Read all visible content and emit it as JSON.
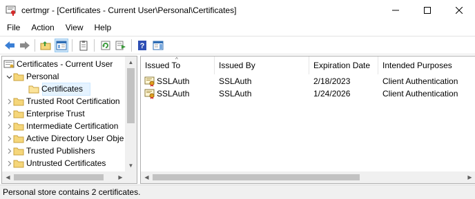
{
  "window": {
    "title": "certmgr - [Certificates - Current User\\Personal\\Certificates]",
    "minimize_icon": "minimize-icon",
    "maximize_icon": "maximize-icon",
    "close_icon": "close-icon"
  },
  "menu": {
    "items": [
      "File",
      "Action",
      "View",
      "Help"
    ]
  },
  "toolbar": {
    "buttons": [
      "back-arrow",
      "forward-arrow",
      "up-folder",
      "show-hide-console-tree",
      "properties",
      "refresh",
      "export-list",
      "help",
      "action-pane"
    ]
  },
  "tree": {
    "root_label": "Certificates - Current User",
    "items": [
      {
        "label": "Personal",
        "level": 1,
        "expanded": true
      },
      {
        "label": "Certificates",
        "level": 2,
        "selected": true
      },
      {
        "label": "Trusted Root Certification",
        "level": 1
      },
      {
        "label": "Enterprise Trust",
        "level": 1
      },
      {
        "label": "Intermediate Certification",
        "level": 1
      },
      {
        "label": "Active Directory User Obje",
        "level": 1
      },
      {
        "label": "Trusted Publishers",
        "level": 1
      },
      {
        "label": "Untrusted Certificates",
        "level": 1
      }
    ]
  },
  "list": {
    "columns": [
      "Issued To",
      "Issued By",
      "Expiration Date",
      "Intended Purposes"
    ],
    "rows": [
      {
        "issued_to": "SSLAuth",
        "issued_by": "SSLAuth",
        "expiration": "2/18/2023",
        "purposes": "Client Authentication"
      },
      {
        "issued_to": "SSLAuth",
        "issued_by": "SSLAuth",
        "expiration": "1/24/2026",
        "purposes": "Client Authentication"
      }
    ]
  },
  "status": {
    "text": "Personal store contains 2 certificates."
  },
  "colors": {
    "selection_bg": "#e5f3ff",
    "folder_yellow": "#f5d67a",
    "folder_dark": "#d8b14a",
    "statusbar_bg": "#f0f0f0"
  }
}
